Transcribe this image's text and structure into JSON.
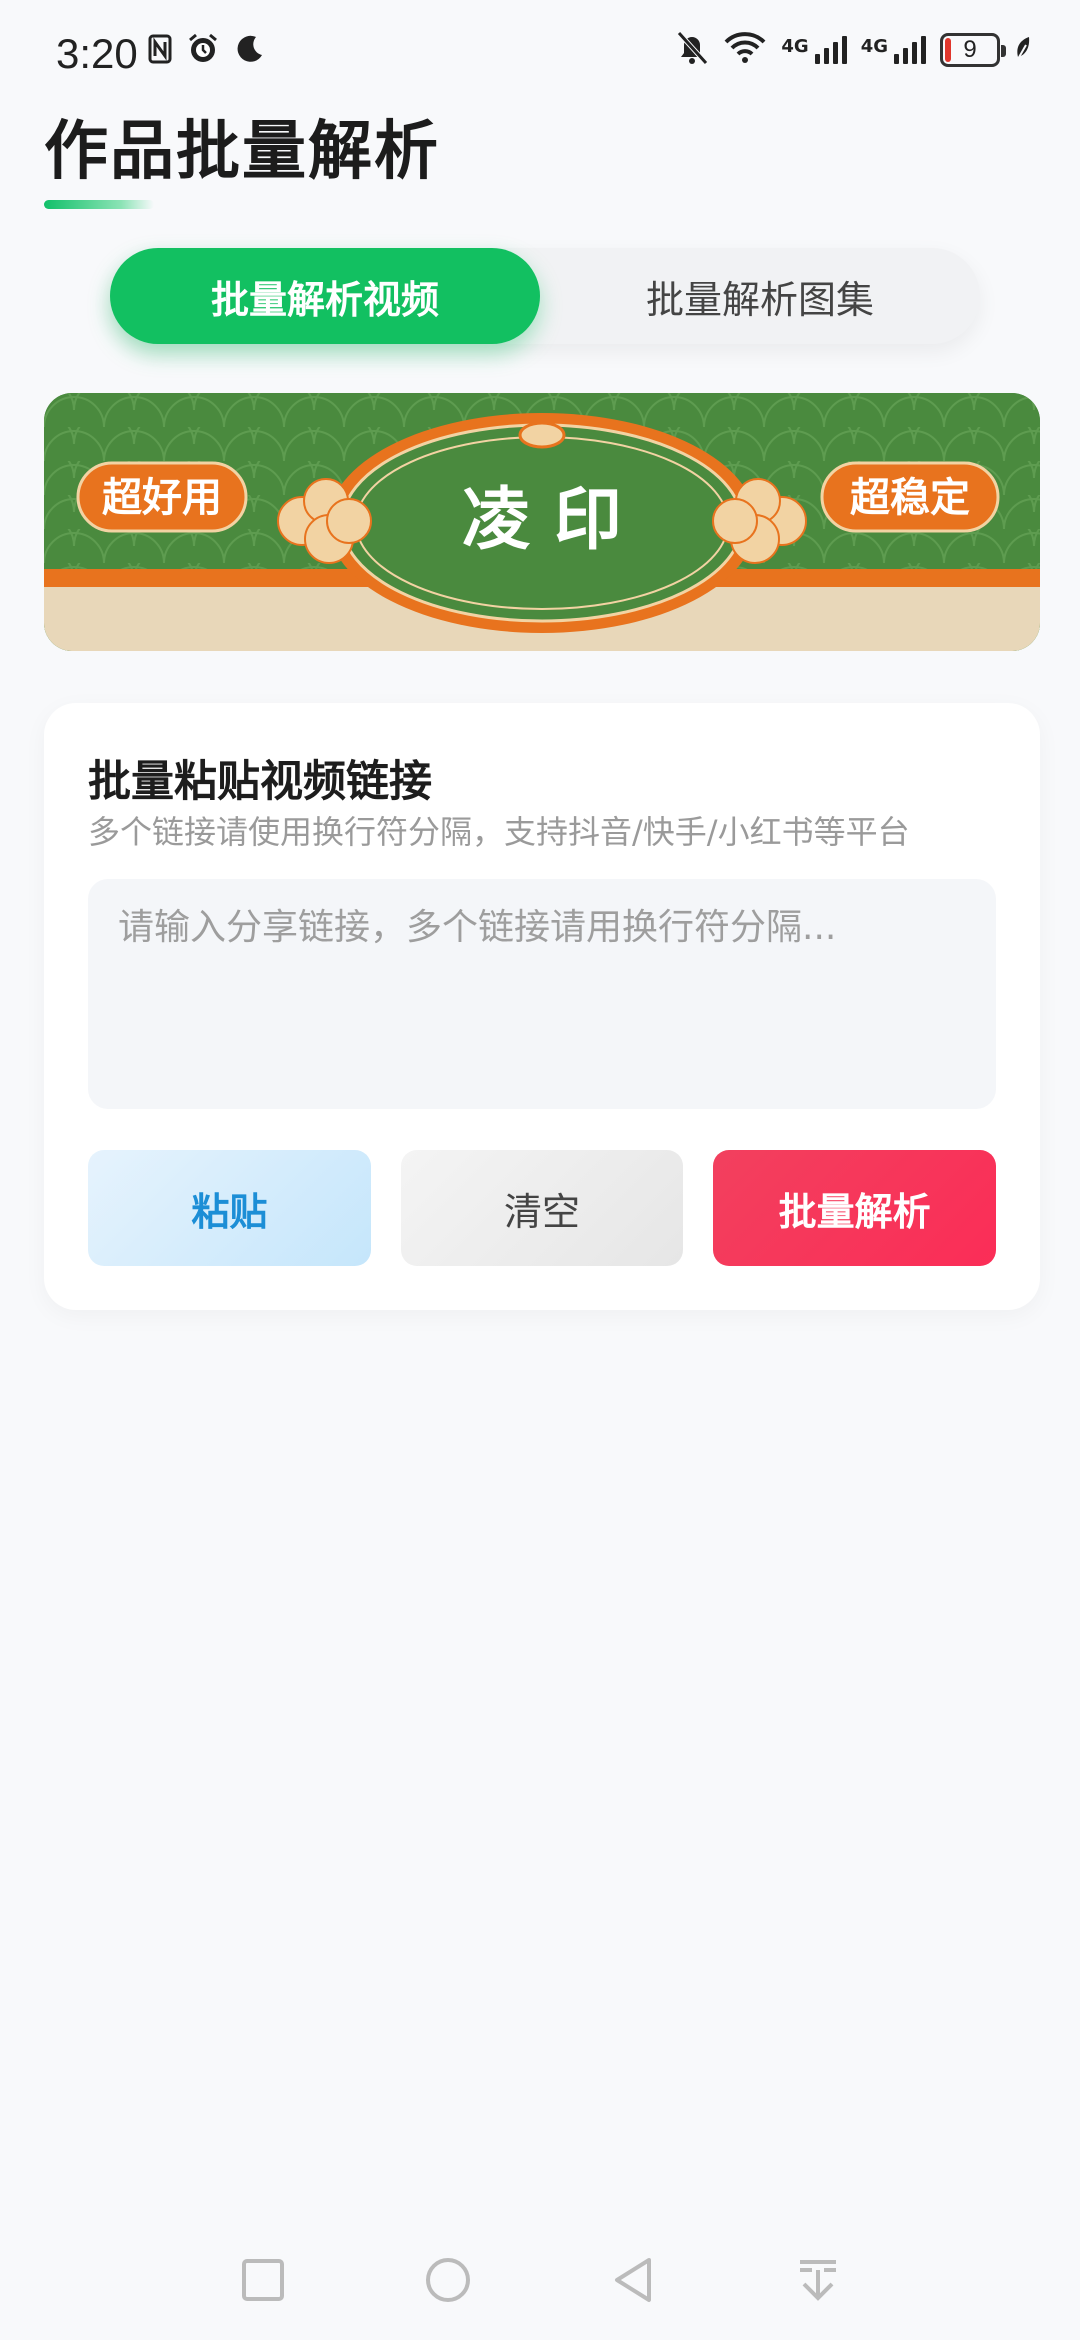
{
  "status_bar": {
    "time": "3:20",
    "signal1_label": "4G",
    "signal2_label": "4G",
    "battery_level": "9"
  },
  "header": {
    "title": "作品批量解析"
  },
  "tabs": [
    {
      "label": "批量解析视频",
      "active": true
    },
    {
      "label": "批量解析图集",
      "active": false
    }
  ],
  "banner": {
    "left_text": "超好用",
    "center_text": "凌 印",
    "right_text": "超稳定"
  },
  "input_card": {
    "title": "批量粘贴视频链接",
    "subtitle": "多个链接请使用换行符分隔，支持抖音/快手/小红书等平台",
    "placeholder": "请输入分享链接，多个链接请用换行符分隔...",
    "value": "",
    "paste_label": "粘贴",
    "clear_label": "清空",
    "parse_label": "批量解析"
  },
  "colors": {
    "accent_green": "#12c061",
    "parse_red": "#fb2d57",
    "paste_blue": "#1c8ed6",
    "banner_green": "#4a8a3e",
    "banner_orange": "#e8731e"
  },
  "nav_bar": {
    "icons": [
      "square-recent-icon",
      "circle-home-icon",
      "triangle-back-icon",
      "down-arrow-hide-icon"
    ]
  }
}
